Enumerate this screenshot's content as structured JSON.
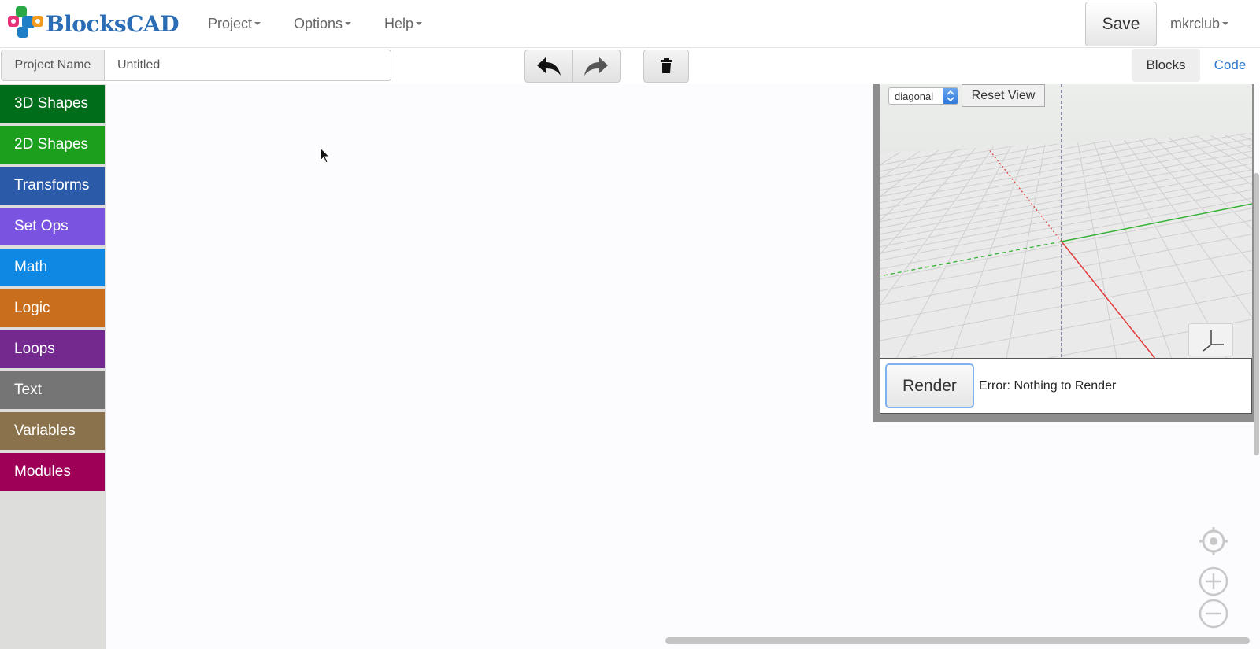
{
  "app": {
    "logo_text": "BlocksCAD",
    "brand_color": "#2a6db5"
  },
  "nav": {
    "menus": [
      {
        "label": "Project"
      },
      {
        "label": "Options"
      },
      {
        "label": "Help"
      }
    ],
    "save_label": "Save",
    "user_label": "mkrclub"
  },
  "project_bar": {
    "name_label": "Project Name",
    "name_value": "Untitled",
    "undo_icon": "undo-arrow-icon",
    "redo_icon": "redo-arrow-icon",
    "trash_icon": "trash-icon",
    "tabs": [
      {
        "label": "Blocks",
        "active": true
      },
      {
        "label": "Code",
        "active": false
      }
    ]
  },
  "categories": [
    {
      "label": "3D Shapes",
      "color": "#006d1b"
    },
    {
      "label": "2D Shapes",
      "color": "#1c9f1c"
    },
    {
      "label": "Transforms",
      "color": "#2b5aa8"
    },
    {
      "label": "Set Ops",
      "color": "#7a54e1"
    },
    {
      "label": "Math",
      "color": "#0f88e4"
    },
    {
      "label": "Logic",
      "color": "#c96e1d"
    },
    {
      "label": "Loops",
      "color": "#73298e"
    },
    {
      "label": "Text",
      "color": "#757575"
    },
    {
      "label": "Variables",
      "color": "#8a734c"
    },
    {
      "label": "Modules",
      "color": "#9e0057"
    }
  ],
  "viewer": {
    "view_mode": "diagonal",
    "reset_label": "Reset View",
    "render_label": "Render",
    "status_text": "Error: Nothing to Render",
    "axis_colors": {
      "x": "#e23a3a",
      "y": "#35b135",
      "z": "#555577"
    }
  },
  "workspace_controls": {
    "recenter_icon": "target-icon",
    "zoom_in_icon": "zoom-in-icon",
    "zoom_out_icon": "zoom-out-icon"
  }
}
